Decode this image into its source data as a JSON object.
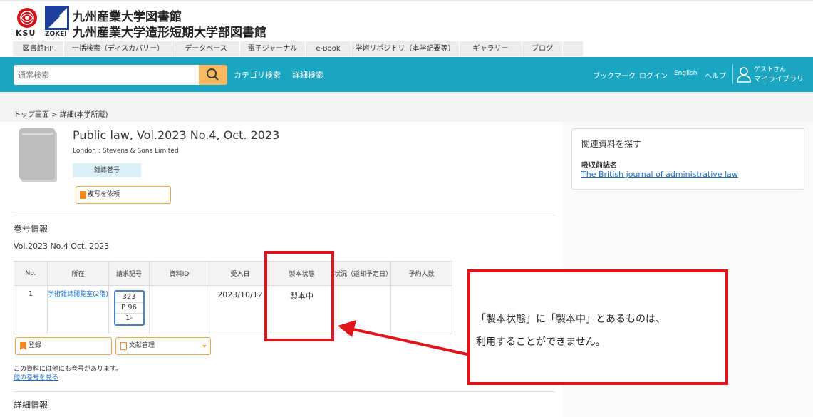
{
  "header": {
    "ksu_mark": "KSU",
    "zokei_mark": "ZOKEI",
    "library_name_1": "九州産業大学図書館",
    "library_name_2": "九州産業大学造形短期大学部図書館"
  },
  "menu": {
    "items": [
      "図書館HP",
      "一括検索（ディスカバリー）",
      "データベース",
      "電子ジャーナル",
      "e-Book",
      "学術リポジトリ（本学紀要等）",
      "ギャラリー",
      "ブログ"
    ]
  },
  "search": {
    "placeholder": "通常検索",
    "category_search": "カテゴリ検索",
    "advanced_search": "詳細検索"
  },
  "user_nav": {
    "bookmark": "ブックマーク",
    "login": "ログイン",
    "english": "English",
    "help": "ヘルプ",
    "guest": "ゲストさん",
    "my_library": "マイライブラリ"
  },
  "breadcrumb": "トップ画面 > 詳細(本学所蔵)",
  "record": {
    "title": "Public law, Vol.2023 No.4, Oct. 2023",
    "publisher": "London : Stevens & Sons Limited",
    "type_badge": "雑誌巻号",
    "copy_request": "複写を依頼"
  },
  "volume_section": {
    "heading": "巻号情報",
    "volume": "Vol.2023 No.4 Oct. 2023",
    "columns": [
      "No.",
      "所在",
      "請求記号",
      "資料ID",
      "受入日",
      "製本状態",
      "状況（返却予定日）",
      "予約人数"
    ],
    "row": {
      "no": "1",
      "location": "学術雑誌閲覧室(2階)",
      "call_number": [
        "323",
        "P 96",
        "1-"
      ],
      "material_id": "",
      "received": "2023/10/12",
      "binding": "製本中",
      "status": "",
      "reservations": ""
    },
    "register_button": "登録",
    "reference_button": "文献管理",
    "note": "この資料には他にも巻号があります。",
    "other_volumes_link": "他の巻号を見る"
  },
  "details_heading": "詳細情報",
  "related": {
    "title": "関連資料を探す",
    "label": "吸収前誌名",
    "link": "The British journal of administrative law"
  },
  "annotation": {
    "line1": "「製本状態」に「製本中」とあるものは、",
    "line2": "利用することができません。"
  },
  "colors": {
    "accent": "#1aa5c0",
    "search_button": "#f8b960",
    "annotation_red": "#e0141b",
    "link": "#1e6fbf"
  }
}
